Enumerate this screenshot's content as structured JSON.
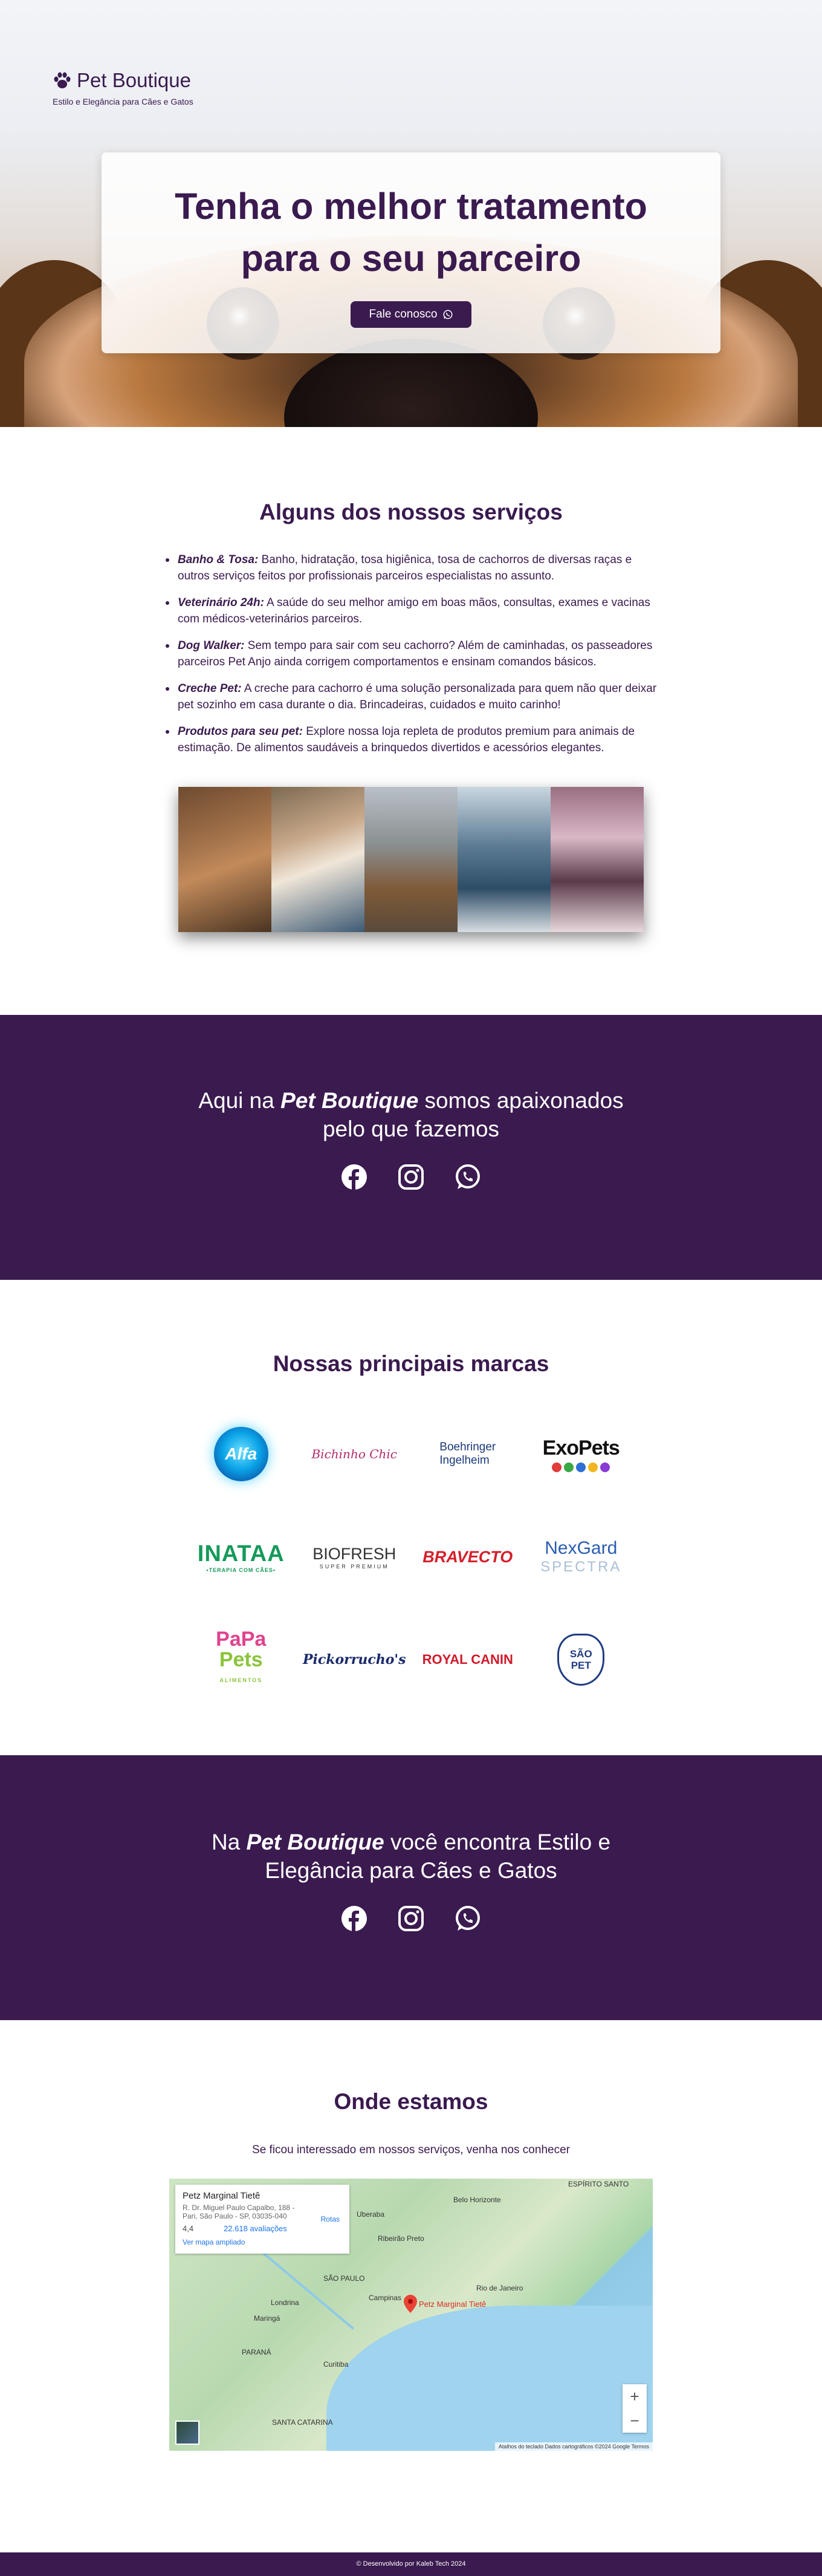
{
  "brand": {
    "name": "Pet Boutique",
    "tagline": "Estilo e Elegância para Cães e Gatos"
  },
  "hero": {
    "title_line1": "Tenha o melhor tratamento",
    "title_line2": "para o seu parceiro",
    "cta_label": "Fale conosco"
  },
  "services": {
    "title": "Alguns dos nossos serviços",
    "items": [
      {
        "name": "Banho & Tosa:",
        "text": " Banho, hidratação, tosa higiênica, tosa de cachorros de diversas raças e outros serviços feitos por profissionais parceiros especialistas no assunto."
      },
      {
        "name": "Veterinário 24h:",
        "text": " A saúde do seu melhor amigo em boas mãos, consultas, exames e vacinas com médicos-veterinários parceiros."
      },
      {
        "name": "Dog Walker:",
        "text": " Sem tempo para sair com seu cachorro? Além de caminhadas, os passeadores parceiros Pet Anjo ainda corrigem comportamentos e ensinam comandos básicos."
      },
      {
        "name": "Creche Pet:",
        "text": " A creche para cachorro é uma solução personalizada para quem não quer deixar pet sozinho em casa durante o dia. Brincadeiras, cuidados e muito carinho!"
      },
      {
        "name": "Produtos para seu pet:",
        "text": " Explore nossa loja repleta de produtos premium para animais de estimação. De alimentos saudáveis a brinquedos divertidos e acessórios elegantes."
      }
    ]
  },
  "passion": {
    "prefix": "Aqui na ",
    "brand": "Pet Boutique",
    "suffix": " somos apaixonados",
    "line2": "pelo que fazemos"
  },
  "brands": {
    "title": "Nossas principais marcas",
    "logos": {
      "alfa": "Alfa",
      "bichinho": "Bichinho Chic",
      "boehringer_1": "Boehringer",
      "boehringer_2": "Ingelheim",
      "exopets": "ExoPets",
      "inataa": "INATAA",
      "inataa_sub": "•TERAPIA COM CÃES•",
      "biofresh": "BIOFRESH",
      "biofresh_sub": "SUPER PREMIUM",
      "bravecto": "BRAVECTO",
      "nexgard": "NexGard",
      "nexgard_sub": "SPECTRA",
      "papa": "PaPa",
      "papa_pets": "Pets",
      "papa_sub": "ALIMENTOS",
      "pickorruchos": "Pickorrucho's",
      "royal": "ROYAL CANIN",
      "sao_pet": "SÃO PET"
    },
    "exopets_dot_colors": [
      "#e23b3b",
      "#3aa845",
      "#2d6fd6",
      "#f2b51f",
      "#8a3bd6"
    ]
  },
  "store": {
    "prefix": "Na ",
    "brand": "Pet Boutique",
    "suffix": " você encontra Estilo e",
    "line2": "Elegância para Cães e Gatos"
  },
  "location": {
    "title": "Onde estamos",
    "subtitle": "Se ficou interessado em nossos serviços, venha nos conhecer",
    "map": {
      "place_name": "Petz Marginal Tietê",
      "address": "R. Dr. Miguel Paulo Capalbo, 188 - Pari, São Paulo - SP, 03035-040",
      "rating": "4,4",
      "reviews": "22.618 avaliações",
      "route": "Rotas",
      "larger_map": "Ver mapa ampliado",
      "pin_label": "Petz Marginal Tietê",
      "cities": {
        "belo_horizonte": "Belo Horizonte",
        "espirito_santo": "ESPÍRITO SANTO",
        "uberaba": "Uberaba",
        "ribeirao_preto": "Ribeirão Preto",
        "sao_paulo_state": "SÃO PAULO",
        "rio_de_janeiro": "Rio de Janeiro",
        "campinas": "Campinas",
        "parana": "PARANÁ",
        "curitiba": "Curitiba",
        "santa_catarina": "SANTA CATARINA",
        "londrina": "Londrina",
        "maringa": "Maringá"
      },
      "zoom_in": "+",
      "zoom_out": "−",
      "attribution": "Atalhos do teclado   Dados cartográficos ©2024 Google   Termos"
    }
  },
  "footer": {
    "text": "© Desenvolvido por Kaleb Tech 2024"
  },
  "colors": {
    "primary": "#3a1a4f",
    "white": "#ffffff"
  }
}
